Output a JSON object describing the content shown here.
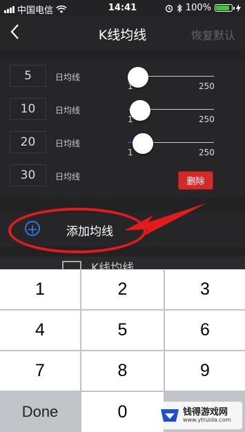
{
  "status_bar": {
    "carrier": "中国电信",
    "time": "14:41",
    "battery": "100%"
  },
  "navbar": {
    "title": "K线均线",
    "restore_label": "恢复默认"
  },
  "ma_rows": [
    {
      "value": "5",
      "label": "日均线",
      "slider_min": "1",
      "slider_max": "250",
      "slider_value": 5
    },
    {
      "value": "10",
      "label": "日均线",
      "slider_min": "1",
      "slider_max": "250",
      "slider_value": 10
    },
    {
      "value": "20",
      "label": "日均线",
      "slider_min": "1",
      "slider_max": "250",
      "slider_value": 20
    },
    {
      "value": "30",
      "label": "日均线",
      "delete_label": "删除"
    }
  ],
  "add_row": {
    "label": "添加均线"
  },
  "peek_row": {
    "label": "K线均线"
  },
  "keyboard": {
    "keys": [
      "1",
      "2",
      "3",
      "4",
      "5",
      "6",
      "7",
      "8",
      "9",
      "Done",
      "0"
    ]
  },
  "watermark": {
    "name": "钱得游戏网",
    "url": "www.ytruida.com"
  },
  "colors": {
    "accent": "#2a7ae2",
    "delete": "#d42a2a",
    "annotation": "#e21b1b"
  }
}
